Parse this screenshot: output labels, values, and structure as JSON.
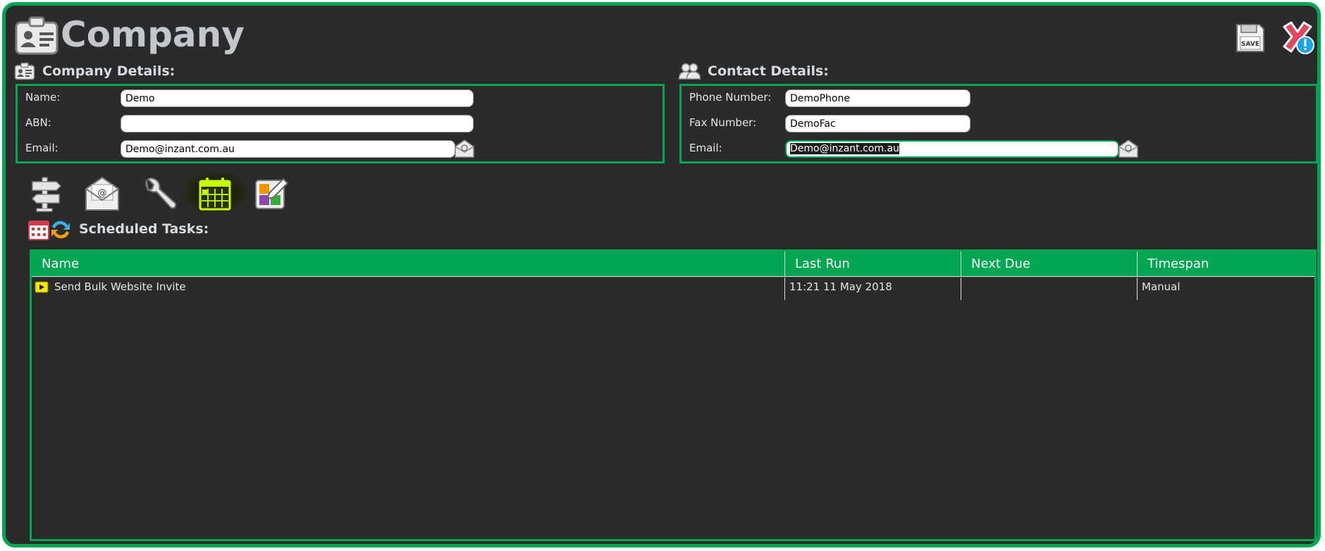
{
  "page": {
    "title": "Company",
    "title_icon": "id-card-icon",
    "save_icon": "floppy-save-icon",
    "save_label": "SAVE",
    "close_icon": "close-x-alert-icon"
  },
  "company_details": {
    "heading": "Company Details:",
    "icon": "id-card-icon",
    "name_label": "Name:",
    "name_value": "Demo",
    "abn_label": "ABN:",
    "abn_value": "",
    "email_label": "Email:",
    "email_value": "Demo@inzant.com.au",
    "email_button_icon": "send-email-icon"
  },
  "contact_details": {
    "heading": "Contact Details:",
    "icon": "people-icon",
    "phone_label": "Phone Number:",
    "phone_value": "DemoPhone",
    "fax_label": "Fax Number:",
    "fax_value": "DemoFac",
    "email_label": "Email:",
    "email_value": "Demo@inzant.com.au",
    "email_button_icon": "send-email-icon"
  },
  "toolbar": {
    "items": [
      {
        "icon": "signpost-icon"
      },
      {
        "icon": "email-envelope-icon"
      },
      {
        "icon": "wrench-icon"
      },
      {
        "icon": "calendar-icon",
        "active": true
      },
      {
        "icon": "color-picker-icon"
      }
    ]
  },
  "scheduled_tasks": {
    "heading": "Scheduled Tasks:",
    "icon": "calendar-refresh-icon",
    "columns": [
      "Name",
      "Last Run",
      "Next Due",
      "Timespan"
    ],
    "rows": [
      {
        "icon": "play-icon",
        "name": "Send Bulk Website Invite",
        "last_run": "11:21 11 May 2018",
        "next_due": "",
        "timespan": "Manual"
      }
    ]
  },
  "colors": {
    "accent": "#00a651",
    "background": "#2b2b2b",
    "title_text": "#c3c6ca",
    "active_calendar": "#c8ff00",
    "alert_badge": "#1aa3e8",
    "close_red": "#e2475e"
  }
}
